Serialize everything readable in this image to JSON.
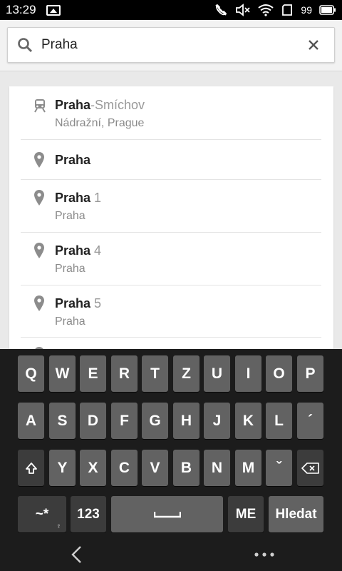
{
  "status_bar": {
    "time": "13:29",
    "battery_level": "99"
  },
  "search": {
    "value": "Praha",
    "placeholder": ""
  },
  "results": [
    {
      "icon": "train-icon",
      "title_bold": "Praha",
      "title_rest": "-Smíchov",
      "subtitle": "Nádražní, Prague"
    },
    {
      "icon": "place-pin-icon",
      "title_bold": "Praha",
      "title_rest": "",
      "subtitle": ""
    },
    {
      "icon": "place-pin-icon",
      "title_bold": "Praha",
      "title_rest": " 1",
      "subtitle": "Praha"
    },
    {
      "icon": "place-pin-icon",
      "title_bold": "Praha",
      "title_rest": " 4",
      "subtitle": "Praha"
    },
    {
      "icon": "place-pin-icon",
      "title_bold": "Praha",
      "title_rest": " 5",
      "subtitle": "Praha"
    }
  ],
  "keyboard": {
    "row1": [
      "Q",
      "W",
      "E",
      "R",
      "T",
      "Z",
      "U",
      "I",
      "O",
      "P"
    ],
    "row2": [
      "A",
      "S",
      "D",
      "F",
      "G",
      "H",
      "J",
      "K",
      "L",
      "´"
    ],
    "row3": [
      "Y",
      "X",
      "C",
      "V",
      "B",
      "N",
      "M",
      "ˇ"
    ],
    "symbols_label": "~*",
    "symbols_hint": "♀",
    "numbers_label": "123",
    "language_label": "ME",
    "search_label": "Hledat"
  }
}
